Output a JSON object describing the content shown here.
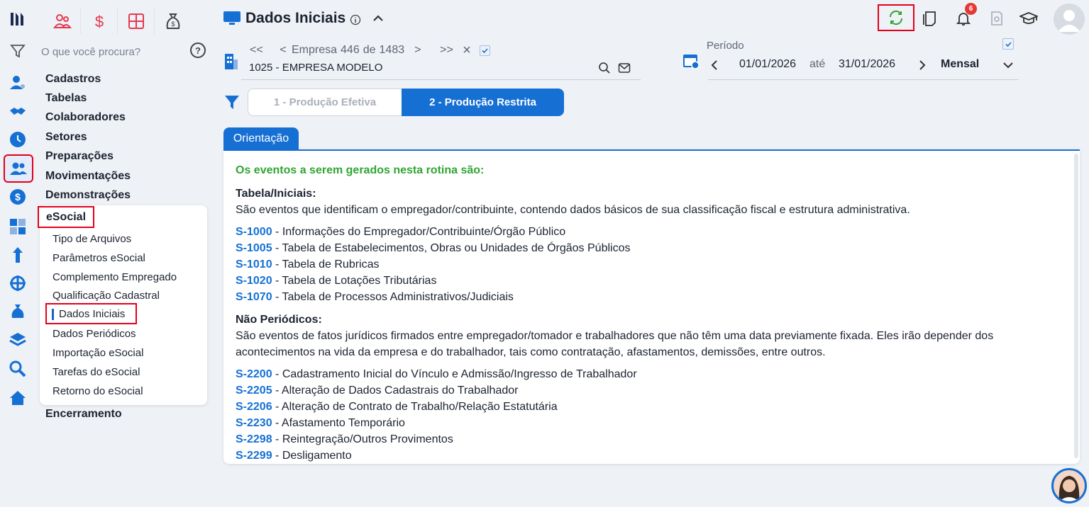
{
  "topbar_icons": [
    "people-icon",
    "dollar-icon",
    "calculator-icon",
    "money-bag-icon"
  ],
  "search": {
    "placeholder": "O que você procura?",
    "help": "?"
  },
  "menu": {
    "items": [
      "Cadastros",
      "Tabelas",
      "Colaboradores",
      "Setores",
      "Preparações",
      "Movimentações",
      "Demonstrações"
    ],
    "esocial": "eSocial",
    "sub": [
      "Tipo de Arquivos",
      "Parâmetros eSocial",
      "Complemento Empregado",
      "Qualificação Cadastral",
      "Dados Iniciais",
      "Dados Periódicos",
      "Importação eSocial",
      "Tarefas do eSocial",
      "Retorno do eSocial"
    ],
    "last": "Encerramento"
  },
  "header": {
    "title": "Dados Iniciais",
    "notifications": "6"
  },
  "empresa": {
    "first": "<<",
    "prev": "<",
    "label": "Empresa",
    "current": "446",
    "of": "de",
    "total": "1483",
    "next": ">",
    "last": ">>",
    "close": "×",
    "name": "1025 - EMPRESA MODELO"
  },
  "periodo": {
    "label": "Período",
    "from": "01/01/2026",
    "until": "até",
    "to": "31/01/2026",
    "type": "Mensal"
  },
  "tabs": [
    "1 - Produção Efetiva",
    "2 - Produção Restrita"
  ],
  "orientacao": {
    "tab": "Orientação",
    "intro": "Os eventos a serem gerados nesta rotina são:",
    "sec1_title": "Tabela/Iniciais:",
    "sec1_desc": "São eventos que identificam o empregador/contribuinte, contendo dados básicos de sua classificação fiscal e estrutura administrativa.",
    "sec1_events": [
      {
        "code": "S-1000",
        "text": " - Informações do Empregador/Contribuinte/Órgão Público"
      },
      {
        "code": "S-1005",
        "text": " - Tabela de Estabelecimentos, Obras ou Unidades de Órgãos Públicos"
      },
      {
        "code": "S-1010",
        "text": " - Tabela de Rubricas"
      },
      {
        "code": "S-1020",
        "text": " - Tabela de Lotações Tributárias"
      },
      {
        "code": "S-1070",
        "text": " - Tabela de Processos Administrativos/Judiciais"
      }
    ],
    "sec2_title": "Não Periódicos:",
    "sec2_desc": "São eventos de fatos jurídicos firmados entre empregador/tomador e trabalhadores que não têm uma data previamente fixada. Eles irão depender dos acontecimentos na vida da empresa e do trabalhador, tais como contratação, afastamentos, demissões, entre outros.",
    "sec2_events": [
      {
        "code": "S-2200",
        "text": " - Cadastramento Inicial do Vínculo e Admissão/Ingresso de Trabalhador"
      },
      {
        "code": "S-2205",
        "text": " - Alteração de Dados Cadastrais do Trabalhador"
      },
      {
        "code": "S-2206",
        "text": " - Alteração de Contrato de Trabalho/Relação Estatutária"
      },
      {
        "code": "S-2230",
        "text": " - Afastamento Temporário"
      },
      {
        "code": "S-2298",
        "text": " - Reintegração/Outros Provimentos"
      },
      {
        "code": "S-2299",
        "text": " - Desligamento"
      }
    ]
  },
  "colors": {
    "accent": "#1670d4",
    "highlight": "#e3001b",
    "intro": "#2fa533"
  }
}
